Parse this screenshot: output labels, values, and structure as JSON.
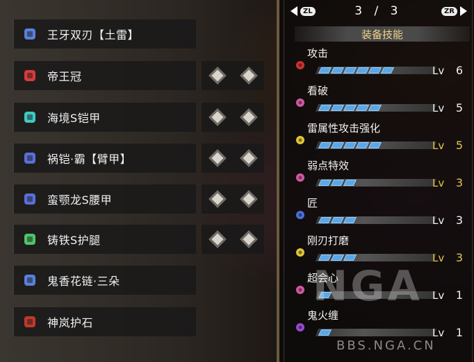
{
  "equipment": [
    {
      "name": "王牙双刃【土雷】",
      "slots": 0,
      "icon": "dual-blades-icon",
      "color": "#5a7fd8"
    },
    {
      "name": "帝王冠",
      "slots": 2,
      "icon": "helmet-icon",
      "color": "#d83a3a"
    },
    {
      "name": "海境S铠甲",
      "slots": 2,
      "icon": "chest-armor-icon",
      "color": "#3fc9c0"
    },
    {
      "name": "祸铠·霸【臂甲】",
      "slots": 2,
      "icon": "arm-armor-icon",
      "color": "#5a6fd8"
    },
    {
      "name": "蛮颚龙S腰甲",
      "slots": 2,
      "icon": "waist-armor-icon",
      "color": "#5a6fd8"
    },
    {
      "name": "铸铁S护腿",
      "slots": 2,
      "icon": "leg-armor-icon",
      "color": "#4fc46a"
    },
    {
      "name": "鬼香花链·三朵",
      "slots": 0,
      "icon": "charm-icon",
      "color": "#5a7fd8"
    },
    {
      "name": "神岚护石",
      "slots": 0,
      "icon": "talisman-icon",
      "color": "#c0392b"
    }
  ],
  "pager": {
    "left_button": "ZL",
    "right_button": "ZR",
    "page": "3 / 3"
  },
  "section_title": "装备技能",
  "level_prefix": "Lv",
  "skills": [
    {
      "name": "攻击",
      "level": 6,
      "max": 7,
      "maxed": false,
      "color": "#d03030"
    },
    {
      "name": "看破",
      "level": 5,
      "max": 7,
      "maxed": false,
      "color": "#d05aa0"
    },
    {
      "name": "雷属性攻击强化",
      "level": 5,
      "max": 5,
      "maxed": true,
      "color": "#e0c53a"
    },
    {
      "name": "弱点特效",
      "level": 3,
      "max": 3,
      "maxed": true,
      "color": "#d05aa0"
    },
    {
      "name": "匠",
      "level": 3,
      "max": 5,
      "maxed": false,
      "color": "#4a6fd8"
    },
    {
      "name": "刚刃打磨",
      "level": 3,
      "max": 3,
      "maxed": true,
      "color": "#e0c53a"
    },
    {
      "name": "超会心",
      "level": 1,
      "max": 3,
      "maxed": false,
      "color": "#d05aa0"
    },
    {
      "name": "鬼火缠",
      "level": 1,
      "max": 3,
      "maxed": false,
      "color": "#9a4ad0"
    }
  ],
  "watermark": {
    "big": "NGA",
    "small": "BBS.NGA.CN"
  }
}
